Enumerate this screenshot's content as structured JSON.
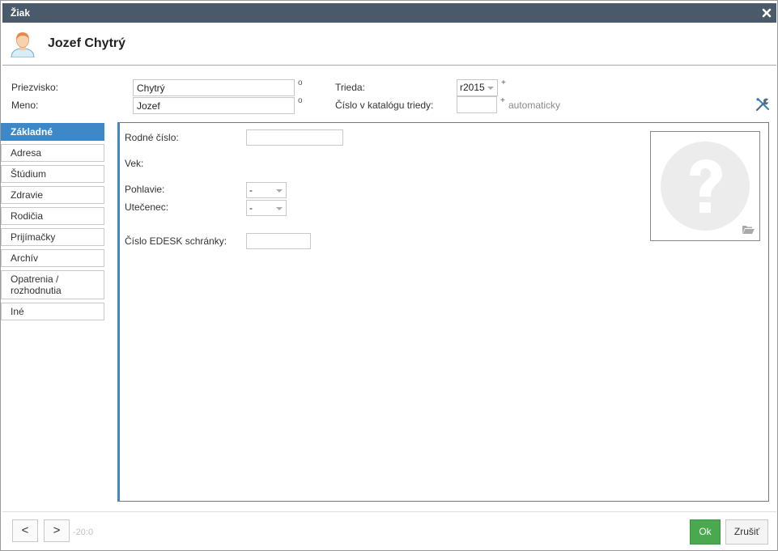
{
  "window": {
    "title": "Žiak",
    "close_icon": "close-icon"
  },
  "header": {
    "name": "Jozef Chytrý",
    "avatar_icon": "user-avatar-icon"
  },
  "form_top": {
    "surname_label": "Priezvisko:",
    "surname_value": "Chytrý",
    "surname_marker": "o",
    "firstname_label": "Meno:",
    "firstname_value": "Jozef",
    "firstname_marker": "o",
    "class_label": "Trieda:",
    "class_value": "r2015",
    "class_marker": "+",
    "catalog_label": "Číslo v katalógu triedy:",
    "catalog_value": "",
    "catalog_marker": "+",
    "catalog_hint": "automaticky",
    "tools_icon": "tools-icon"
  },
  "tabs": [
    {
      "label": "Základné",
      "active": true
    },
    {
      "label": "Adresa",
      "active": false
    },
    {
      "label": "Štúdium",
      "active": false
    },
    {
      "label": "Zdravie",
      "active": false
    },
    {
      "label": "Rodičia",
      "active": false
    },
    {
      "label": "Prijímačky",
      "active": false
    },
    {
      "label": "Archív",
      "active": false
    },
    {
      "label": "Opatrenia / rozhodnutia",
      "active": false
    },
    {
      "label": "Iné",
      "active": false
    }
  ],
  "basic": {
    "birth_number_label": "Rodné číslo:",
    "birth_number_value": "",
    "age_label": "Vek:",
    "gender_label": "Pohlavie:",
    "gender_value": "-",
    "refugee_label": "Utečenec:",
    "refugee_value": "-",
    "edesk_label": "Číslo EDESK schránky:",
    "edesk_value": "",
    "photo_placeholder_icon": "question-mark-icon",
    "photo_folder_icon": "folder-open-icon"
  },
  "footer": {
    "prev_label": "<",
    "next_label": ">",
    "counter": "-20:0",
    "ok_label": "Ok",
    "cancel_label": "Zrušiť"
  },
  "colors": {
    "titlebar": "#4a5a6a",
    "active_tab": "#3f88c8",
    "ok_button": "#4aa84f"
  }
}
